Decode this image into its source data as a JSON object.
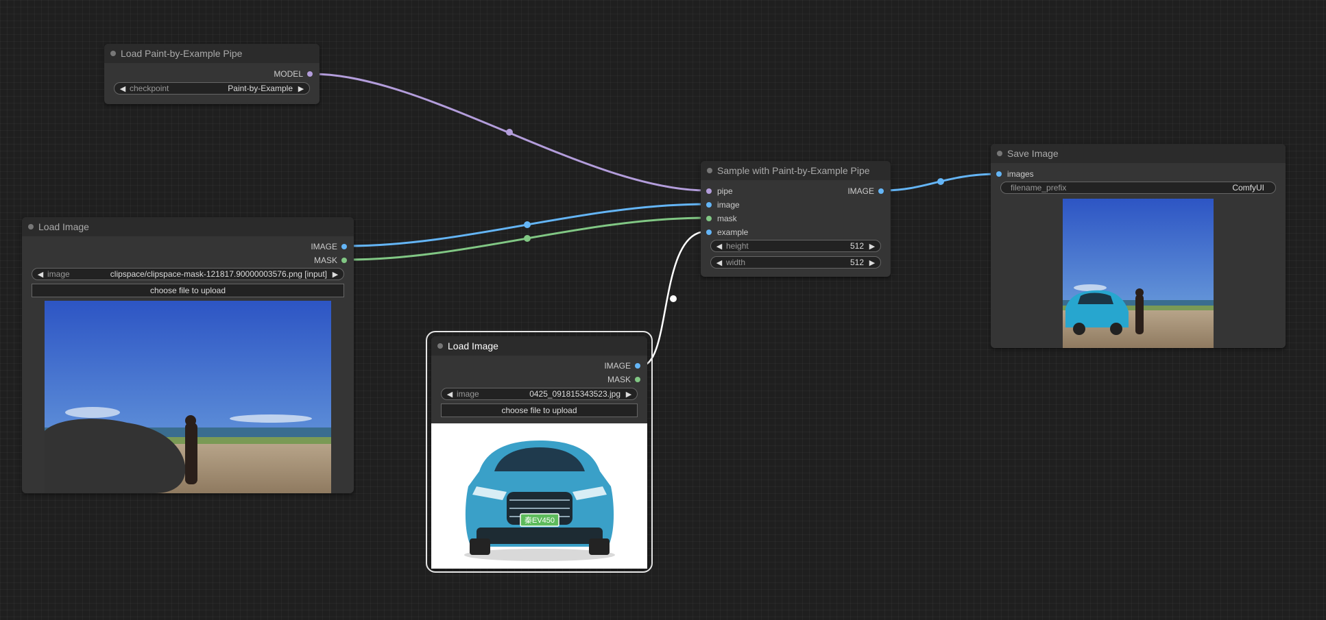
{
  "colors": {
    "canvas": "#1f1f1f",
    "node_body": "#353535",
    "node_title": "#2b2b2b",
    "model_link": "#b39ddb",
    "image_link": "#64b5f6",
    "mask_link": "#81c784",
    "selected_link": "#ffffff"
  },
  "nodes": {
    "load_pipe": {
      "title": "Load Paint-by-Example Pipe",
      "output_model": "MODEL",
      "checkpoint_label": "checkpoint",
      "checkpoint_value": "Paint-by-Example"
    },
    "load_image_left": {
      "title": "Load Image",
      "output_image": "IMAGE",
      "output_mask": "MASK",
      "image_label": "image",
      "image_value": "clipspace/clipspace-mask-121817.90000003576.png [input]",
      "upload_label": "choose file to upload"
    },
    "load_image_center": {
      "title": "Load Image",
      "output_image": "IMAGE",
      "output_mask": "MASK",
      "image_label": "image",
      "image_value": "0425_091815343523.jpg",
      "upload_label": "choose file to upload",
      "plate_text": "秦EV450"
    },
    "sampler": {
      "title": "Sample with Paint-by-Example Pipe",
      "input_pipe": "pipe",
      "input_image": "image",
      "input_mask": "mask",
      "input_example": "example",
      "output_image": "IMAGE",
      "height_label": "height",
      "height_value": "512",
      "width_label": "width",
      "width_value": "512"
    },
    "save_image": {
      "title": "Save Image",
      "input_images": "images",
      "prefix_label": "filename_prefix",
      "prefix_value": "ComfyUI"
    }
  },
  "icons": {
    "arrow_left": "◀",
    "arrow_right": "▶"
  }
}
